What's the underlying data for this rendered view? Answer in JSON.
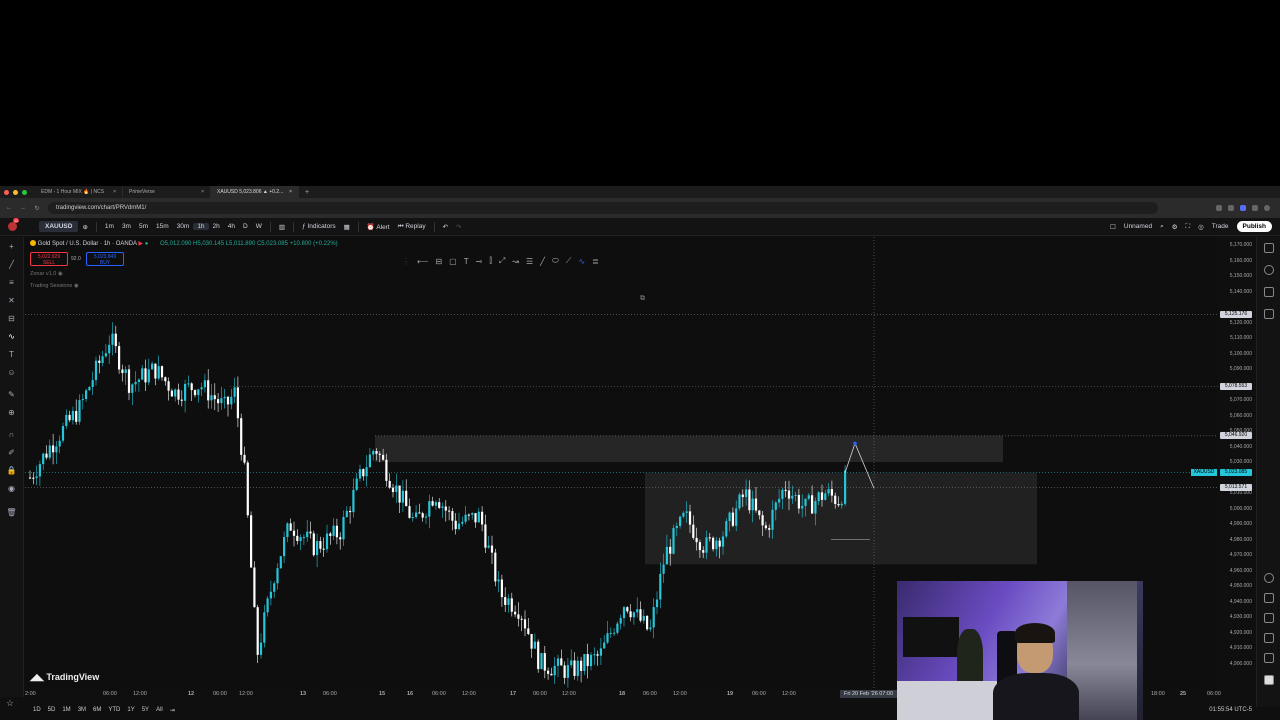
{
  "browser": {
    "tabs": [
      {
        "label": "EDM - 1 Hour MIX 🔥 | NCS",
        "active": false
      },
      {
        "label": "PrimeVerse",
        "active": false
      },
      {
        "label": "XAUUSD 5,023.806 ▲ +0.2...",
        "active": true
      }
    ],
    "url": "tradingview.com/chart/PRVdmM1/"
  },
  "toolbar": {
    "symbol": "XAUUSD",
    "intervals": [
      "1m",
      "3m",
      "5m",
      "15m",
      "30m",
      "1h",
      "2h",
      "4h",
      "D",
      "W"
    ],
    "active_interval": "1h",
    "indicators": "Indicators",
    "alert": "Alert",
    "replay": "Replay",
    "layout_name": "Unnamed",
    "trade": "Trade",
    "publish": "Publish",
    "notification_count": "11"
  },
  "legend": {
    "title": "Gold Spot / U.S. Dollar · 1h · OANDA",
    "ohlc": "O5,012.090 H5,030.145 L5,011.890 C5,023.085 +10.800 (+0.22%)",
    "sell_price": "5,022.929",
    "sell_label": "SELL",
    "spread": "92.0",
    "buy_price": "5,023.849",
    "buy_label": "BUY",
    "indicator1": "Zonar v1.0",
    "indicator2": "Trading Sessions"
  },
  "price_axis": {
    "labels": [
      "5,170.000",
      "5,160.000",
      "5,150.000",
      "5,140.000",
      "5,120.000",
      "5,110.000",
      "5,100.000",
      "5,090.000",
      "5,070.000",
      "5,060.000",
      "5,050.000",
      "5,040.000",
      "5,030.000",
      "5,010.000",
      "5,000.000",
      "4,990.000",
      "4,980.000",
      "4,970.000",
      "4,960.000",
      "4,950.000",
      "4,940.000",
      "4,930.000",
      "4,920.000",
      "4,910.000",
      "4,900.000"
    ],
    "tags": [
      {
        "text": "5,125.176",
        "bg": "#d1d4dc",
        "fg": "#000"
      },
      {
        "text": "5,078.553",
        "bg": "#d1d4dc",
        "fg": "#000"
      },
      {
        "text": "5,046.920",
        "bg": "#d1d4dc",
        "fg": "#000"
      },
      {
        "text": "5,023.085",
        "bg": "#26c6da",
        "fg": "#000"
      },
      {
        "text": "5,013.571",
        "bg": "#d1d4dc",
        "fg": "#000"
      }
    ],
    "current_symbol_tag": "XAUUSD"
  },
  "time_axis": {
    "labels": [
      "2:00",
      "06:00",
      "12:00",
      "12",
      "06:00",
      "12:00",
      "13",
      "06:00",
      "15",
      "16",
      "06:00",
      "12:00",
      "17",
      "06:00",
      "12:00",
      "18",
      "06:00",
      "12:00",
      "19",
      "06:00",
      "12:00",
      "18:00",
      "25",
      "06:00"
    ],
    "crosshair_date": "Fri 20 Feb '26 07:00"
  },
  "bottom": {
    "ranges": [
      "1D",
      "5D",
      "1M",
      "3M",
      "6M",
      "YTD",
      "1Y",
      "5Y",
      "All"
    ],
    "clock": "01:55:54 UTC-5"
  },
  "brand": "TradingView",
  "colors": {
    "candle_up": "#26c6da",
    "candle_down": "#ffffff",
    "zone": "#3a3a3a",
    "accent": "#2962ff"
  }
}
